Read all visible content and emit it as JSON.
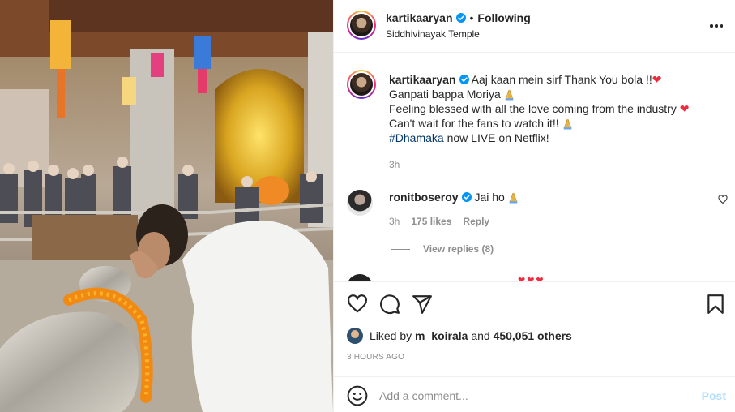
{
  "post": {
    "author": "kartikaaryan",
    "follow_status": "Following",
    "location": "Siddhivinayak Temple",
    "image_description_icon": "temple-photo"
  },
  "caption": {
    "username": "kartikaaryan",
    "line1": "Aaj kaan mein sirf Thank You bola !!",
    "line2": "Ganpati bappa Moriya",
    "line3": "Feeling blessed with all the love coming from the industry",
    "line4": "Can't wait for the fans to watch it!!",
    "hashtag": "#Dhamaka",
    "line5_rest": " now LIVE on Netflix!",
    "time": "3h"
  },
  "comment": {
    "username": "ronitboseroy",
    "text": "Jai ho",
    "time": "3h",
    "likes": "175 likes",
    "reply": "Reply",
    "view_replies": "View replies (8)"
  },
  "likes": {
    "prefix": "Liked by",
    "user": "m_koirala",
    "and": "and",
    "count": "450,051 others"
  },
  "timestamp": "3 HOURS AGO",
  "add_comment": {
    "placeholder": "Add a comment...",
    "post_label": "Post"
  },
  "colors": {
    "verified": "#0095f6",
    "heart": "#ed2d3f",
    "hashtag": "#00376b",
    "muted": "#8e8e8e",
    "post_disabled": "#b2dffc"
  }
}
